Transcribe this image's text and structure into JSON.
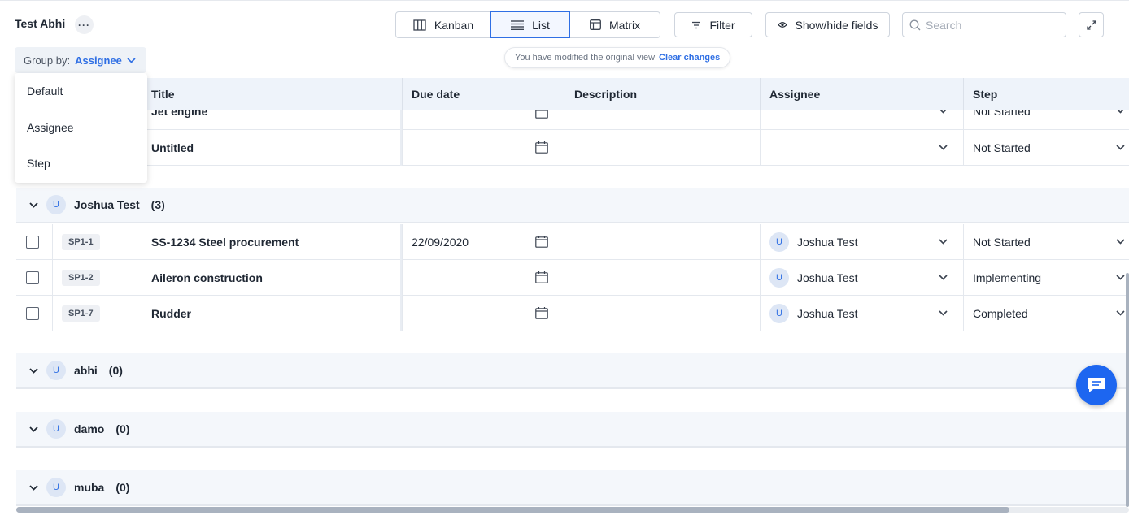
{
  "view": {
    "title": "Test Abhi",
    "more": "···"
  },
  "toolbar": {
    "kanban": "Kanban",
    "list": "List",
    "matrix": "Matrix",
    "filter": "Filter",
    "show_hide": "Show/hide fields",
    "search_placeholder": "Search"
  },
  "group_by": {
    "label": "Group by:",
    "value": "Assignee"
  },
  "modified": {
    "text": "You have modified the original view",
    "link": "Clear changes"
  },
  "dropdown": {
    "items": [
      "Default",
      "Assignee",
      "Step"
    ]
  },
  "columns": [
    "Title",
    "Due date",
    "Description",
    "Assignee",
    "Step"
  ],
  "rows_top": [
    {
      "title": "Jet engine",
      "due": "",
      "assignee": "",
      "step": "Not Started"
    },
    {
      "title": "Untitled",
      "due": "",
      "assignee": "",
      "step": "Not Started"
    }
  ],
  "groups": [
    {
      "avatar": "U",
      "name": "Joshua Test",
      "count": "(3)",
      "rows": [
        {
          "id": "SP1-1",
          "title": "SS-1234 Steel procurement",
          "due": "22/09/2020",
          "avatar": "U",
          "assignee": "Joshua Test",
          "step": "Not Started"
        },
        {
          "id": "SP1-2",
          "title": "Aileron construction",
          "due": "",
          "avatar": "U",
          "assignee": "Joshua Test",
          "step": "Implementing"
        },
        {
          "id": "SP1-7",
          "title": "Rudder",
          "due": "",
          "avatar": "U",
          "assignee": "Joshua Test",
          "step": "Completed"
        }
      ]
    },
    {
      "avatar": "U",
      "name": "abhi",
      "count": "(0)"
    },
    {
      "avatar": "U",
      "name": "damo",
      "count": "(0)"
    },
    {
      "avatar": "U",
      "name": "muba",
      "count": "(0)"
    }
  ],
  "colors": {
    "accent": "#2f6fe4",
    "chat": "#1d66f0",
    "header_bg": "#eef3fa"
  }
}
